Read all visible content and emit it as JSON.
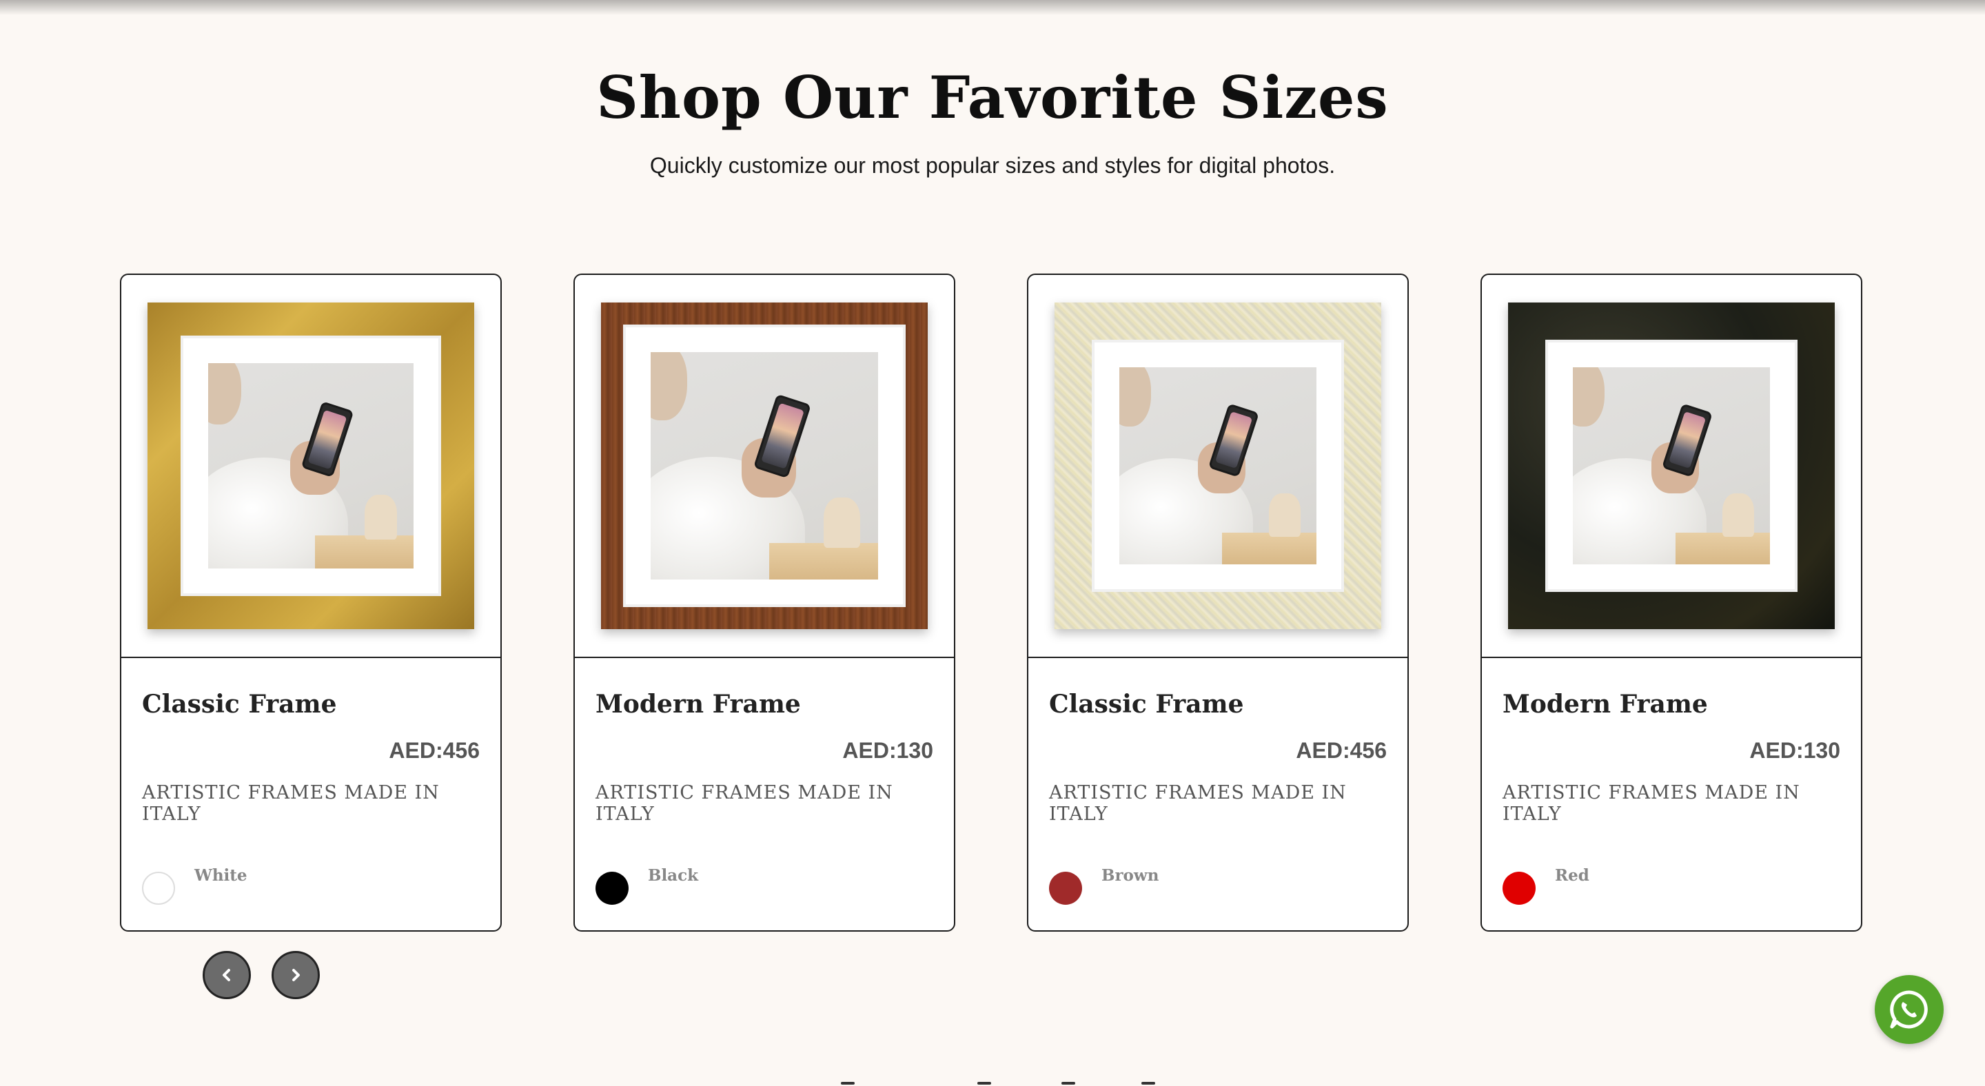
{
  "section": {
    "heading": "Shop Our Favorite Sizes",
    "subheading": "Quickly customize our most popular sizes and styles for digital photos."
  },
  "products": [
    {
      "title": "Classic Frame",
      "price": "AED:456",
      "tagline": "ARTISTIC FRAMES MADE IN ITALY",
      "color_label": "White",
      "swatch_color": "#ffffff",
      "frame_finish": "gold"
    },
    {
      "title": "Modern Frame",
      "price": "AED:130",
      "tagline": "ARTISTIC FRAMES MADE IN ITALY",
      "color_label": "Black",
      "swatch_color": "#000000",
      "frame_finish": "walnut"
    },
    {
      "title": "Classic Frame",
      "price": "AED:456",
      "tagline": "ARTISTIC FRAMES MADE IN ITALY",
      "color_label": "Brown",
      "swatch_color": "#a02a2a",
      "frame_finish": "cream"
    },
    {
      "title": "Modern Frame",
      "price": "AED:130",
      "tagline": "ARTISTIC FRAMES MADE IN ITALY",
      "color_label": "Red",
      "swatch_color": "#e00000",
      "frame_finish": "dark-burl"
    }
  ],
  "carousel": {
    "prev_icon": "chevron-left-icon",
    "next_icon": "chevron-right-icon"
  },
  "floating": {
    "whatsapp_icon": "whatsapp-icon",
    "whatsapp_color": "#55a62a"
  },
  "colors": {
    "page_background": "#fcf8f4",
    "card_border": "#1c1c1c",
    "nav_button": "#6b6b6b"
  }
}
